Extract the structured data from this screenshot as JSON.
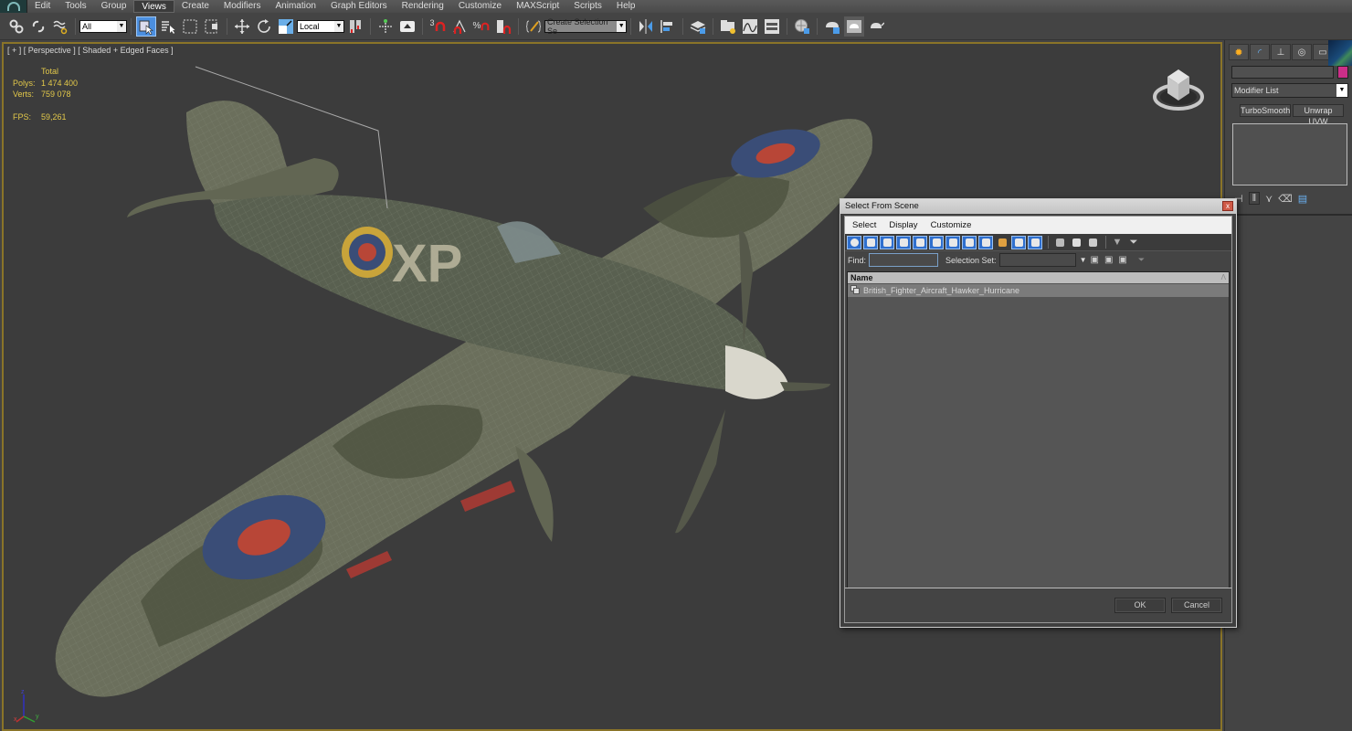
{
  "menubar": {
    "items": [
      "Edit",
      "Tools",
      "Group",
      "Views",
      "Create",
      "Modifiers",
      "Animation",
      "Graph Editors",
      "Rendering",
      "Customize",
      "MAXScript",
      "Scripts",
      "Help"
    ],
    "active": "Views"
  },
  "toolbar": {
    "selection_filter": "All",
    "reference_coord": "Local",
    "named_selection_placeholder": "Create Selection Se",
    "snap_label": "3"
  },
  "viewport": {
    "label": "[ + ] [ Perspective ] [ Shaded + Edged Faces ]",
    "stats": {
      "header": "Total",
      "polys_label": "Polys:",
      "polys_value": "1 474 400",
      "verts_label": "Verts:",
      "verts_value": "759 078",
      "fps_label": "FPS:",
      "fps_value": "59,261"
    },
    "axis": {
      "x": "x",
      "y": "y",
      "z": "z"
    },
    "model_markings": "XP"
  },
  "command_panel": {
    "modifier_list": "Modifier List",
    "buttons": [
      "TurboSmooth",
      "Unwrap UVW"
    ],
    "object_color": "#cc2e88"
  },
  "dialog": {
    "title": "Select From Scene",
    "close_label": "x",
    "menu": [
      "Select",
      "Display",
      "Customize"
    ],
    "find_label": "Find:",
    "find_value": "",
    "selection_set_label": "Selection Set:",
    "selection_set_value": "",
    "column_header": "Name",
    "rows": [
      "British_Fighter_Aircraft_Hawker_Hurricane"
    ],
    "ok_label": "OK",
    "cancel_label": "Cancel"
  },
  "colors": {
    "viewport_border": "#8a7428",
    "stats_text": "#e2c84a",
    "active_button": "#4b8fe0"
  }
}
